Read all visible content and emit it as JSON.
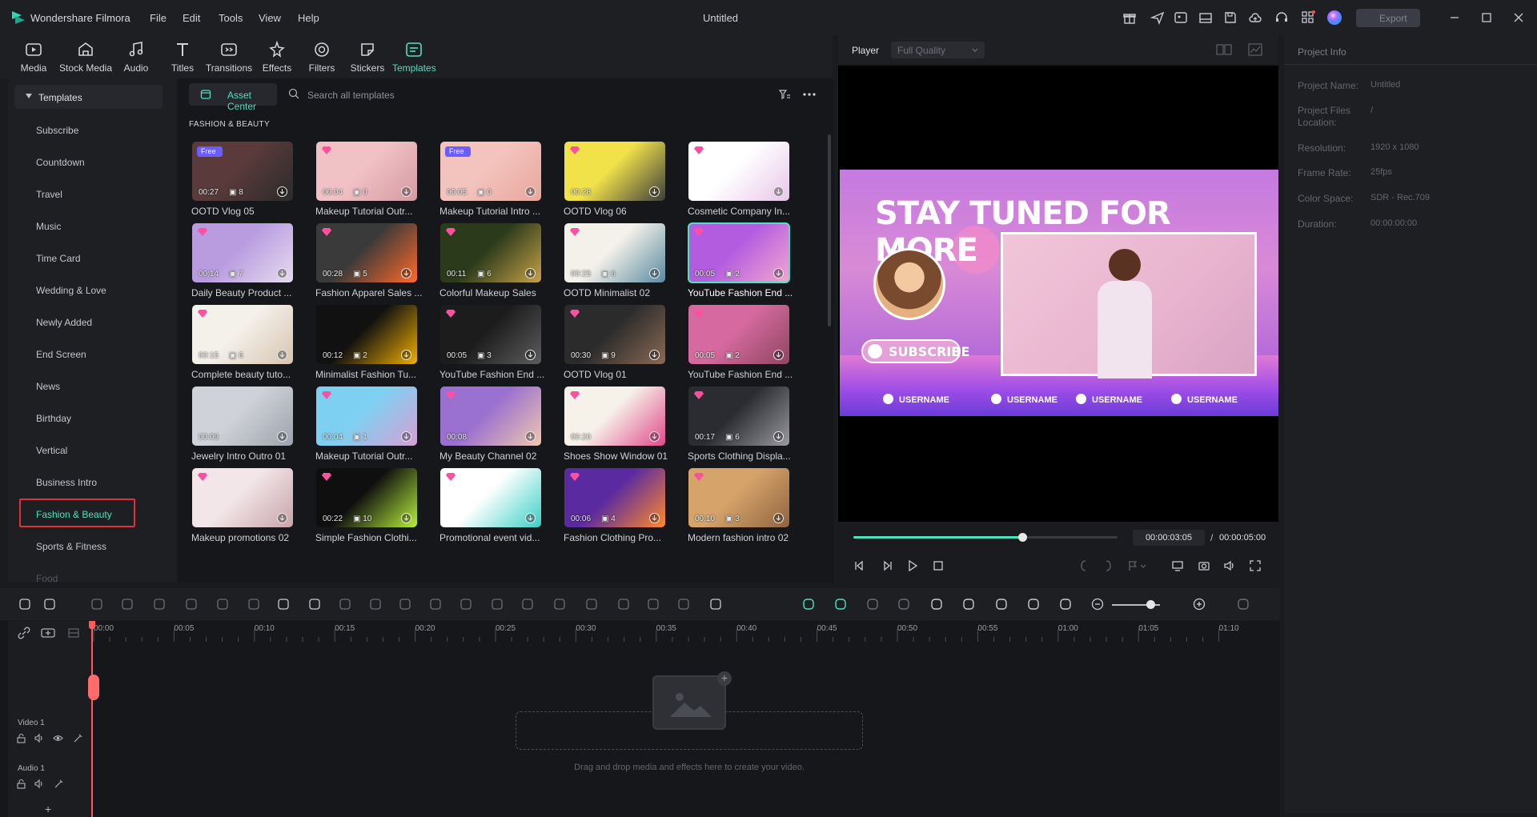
{
  "app": {
    "name": "Wondershare Filmora",
    "window_title": "Untitled",
    "menus": [
      "File",
      "Edit",
      "Tools",
      "View",
      "Help"
    ],
    "export_label": "Export"
  },
  "toolbar": {
    "tools": [
      {
        "label": "Media",
        "icon": "media-icon"
      },
      {
        "label": "Stock Media",
        "icon": "stock-media-icon"
      },
      {
        "label": "Audio",
        "icon": "audio-icon"
      },
      {
        "label": "Titles",
        "icon": "titles-icon"
      },
      {
        "label": "Transitions",
        "icon": "transitions-icon"
      },
      {
        "label": "Effects",
        "icon": "effects-icon"
      },
      {
        "label": "Filters",
        "icon": "filters-icon"
      },
      {
        "label": "Stickers",
        "icon": "stickers-icon"
      },
      {
        "label": "Templates",
        "icon": "templates-icon",
        "active": true
      }
    ]
  },
  "sidebar": {
    "header": "Templates",
    "categories": [
      "Subscribe",
      "Countdown",
      "Travel",
      "Music",
      "Time Card",
      "Wedding & Love",
      "Newly Added",
      "End Screen",
      "News",
      "Birthday",
      "Vertical",
      "Business Intro",
      "Fashion & Beauty",
      "Sports & Fitness",
      "Food"
    ],
    "selected": "Fashion & Beauty"
  },
  "browser": {
    "asset_center_label": "Asset Center",
    "search_placeholder": "Search all templates",
    "section_title": "FASHION & BEAUTY",
    "cards": [
      {
        "title": "OOTD Vlog 05",
        "duration": "00:27",
        "count": "8",
        "badge": "free"
      },
      {
        "title": "Makeup Tutorial Outr...",
        "duration": "00:04",
        "count": "0",
        "badge": "gem"
      },
      {
        "title": "Makeup Tutorial Intro ...",
        "duration": "00:05",
        "count": "0",
        "badge": "free"
      },
      {
        "title": "OOTD Vlog 06",
        "duration": "00:28",
        "count": "",
        "badge": "gem"
      },
      {
        "title": "Cosmetic Company In...",
        "duration": "",
        "count": "",
        "badge": "gem"
      },
      {
        "title": "Daily Beauty Product ...",
        "duration": "00:14",
        "count": "7",
        "badge": "gem"
      },
      {
        "title": "Fashion Apparel Sales ...",
        "duration": "00:28",
        "count": "5",
        "badge": "gem"
      },
      {
        "title": "Colorful Makeup Sales",
        "duration": "00:11",
        "count": "6",
        "badge": "gem"
      },
      {
        "title": "OOTD Minimalist 02",
        "duration": "00:25",
        "count": "6",
        "badge": "gem"
      },
      {
        "title": "YouTube Fashion End ...",
        "duration": "00:05",
        "count": "2",
        "badge": "gem",
        "selected": true
      },
      {
        "title": "Complete beauty tuto...",
        "duration": "00:15",
        "count": "6",
        "badge": "gem"
      },
      {
        "title": "Minimalist Fashion Tu...",
        "duration": "00:12",
        "count": "2",
        "badge": ""
      },
      {
        "title": "YouTube Fashion End ...",
        "duration": "00:05",
        "count": "3",
        "badge": "gem"
      },
      {
        "title": "OOTD Vlog 01",
        "duration": "00:30",
        "count": "9",
        "badge": "gem"
      },
      {
        "title": "YouTube Fashion End ...",
        "duration": "00:05",
        "count": "2",
        "badge": "gem"
      },
      {
        "title": "Jewelry Intro Outro 01",
        "duration": "00:09",
        "count": "",
        "badge": ""
      },
      {
        "title": "Makeup Tutorial Outr...",
        "duration": "00:04",
        "count": "1",
        "badge": "gem"
      },
      {
        "title": "My Beauty Channel 02",
        "duration": "00:08",
        "count": "",
        "badge": "gem"
      },
      {
        "title": "Shoes Show Window 01",
        "duration": "00:20",
        "count": "",
        "badge": "gem"
      },
      {
        "title": "Sports Clothing Displa...",
        "duration": "00:17",
        "count": "6",
        "badge": "gem"
      },
      {
        "title": "Makeup promotions 02",
        "duration": "",
        "count": "",
        "badge": "gem"
      },
      {
        "title": "Simple Fashion Clothi...",
        "duration": "00:22",
        "count": "10",
        "badge": "gem"
      },
      {
        "title": "Promotional event vid...",
        "duration": "",
        "count": "",
        "badge": "gem"
      },
      {
        "title": "Fashion Clothing Pro...",
        "duration": "00:06",
        "count": "4",
        "badge": "gem"
      },
      {
        "title": "Modern fashion intro 02",
        "duration": "00:10",
        "count": "3",
        "badge": "gem"
      }
    ],
    "thumb_colors": [
      [
        "#5a3a3a",
        "#2b2b2b"
      ],
      [
        "#f0c2c6",
        "#d49aa2"
      ],
      [
        "#f3c4bd",
        "#e8a79e"
      ],
      [
        "#f2e24a",
        "#3d3d3d"
      ],
      [
        "#ffffff",
        "#e7c6e9"
      ],
      [
        "#b99ce0",
        "#e6dcef"
      ],
      [
        "#3a3a3a",
        "#ff6a2a"
      ],
      [
        "#2a3a1a",
        "#c7a14a"
      ],
      [
        "#f4f1ea",
        "#5a8aa0"
      ],
      [
        "#b45ce0",
        "#f3a7d0"
      ],
      [
        "#f4f0ea",
        "#d7c5b0"
      ],
      [
        "#111111",
        "#f1b000"
      ],
      [
        "#1c1c1c",
        "#5d5d5d"
      ],
      [
        "#2b2b2b",
        "#8a6a55"
      ],
      [
        "#d66aa0",
        "#8f4560"
      ],
      [
        "#cfd2d8",
        "#9da3ad"
      ],
      [
        "#7ed0f2",
        "#d6a0d4"
      ],
      [
        "#9a70d0",
        "#f0c8b0"
      ],
      [
        "#f6f1e9",
        "#e04a8a"
      ],
      [
        "#2a2c31",
        "#9a9aa0"
      ],
      [
        "#f2e6e8",
        "#c8a3aa"
      ],
      [
        "#0f0f0f",
        "#b8f03a"
      ],
      [
        "#ffffff",
        "#3ad0c6"
      ],
      [
        "#5a2aa0",
        "#ff8a2a"
      ],
      [
        "#d6a36a",
        "#8f6440"
      ]
    ]
  },
  "player": {
    "label": "Player",
    "quality": "Full Quality",
    "current_time": "00:00:03:05",
    "total_time": "00:00:05:00",
    "progress": 0.64,
    "preview": {
      "title": "STAY TUNED FOR MORE",
      "subscribe": "SUBSCRIBE",
      "socials": [
        "USERNAME",
        "USERNAME",
        "USERNAME",
        "USERNAME"
      ]
    }
  },
  "project_info": {
    "title": "Project Info",
    "rows": [
      {
        "key": "Project Name:",
        "value": "Untitled"
      },
      {
        "key": "Project Files Location:",
        "value": "/"
      },
      {
        "key": "Resolution:",
        "value": "1920 x 1080"
      },
      {
        "key": "Frame Rate:",
        "value": "25fps"
      },
      {
        "key": "Color Space:",
        "value": "SDR - Rec.709"
      },
      {
        "key": "Duration:",
        "value": "00:00:00:00"
      }
    ]
  },
  "timeline": {
    "ticks": [
      "00:00",
      "00:05",
      "00:10",
      "00:15",
      "00:20",
      "00:25",
      "00:30",
      "00:35",
      "00:40",
      "00:45",
      "00:50",
      "00:55",
      "01:00",
      "01:05",
      "01:10"
    ],
    "tracks": [
      "Video 1",
      "Audio 1"
    ],
    "drop_text": "Drag and drop media and effects here to create your video.",
    "zoom": 0.8
  },
  "colors": {
    "accent": "#4ee1c1",
    "selection_outline": "#e0303a",
    "playhead": "#ff5a5a"
  }
}
